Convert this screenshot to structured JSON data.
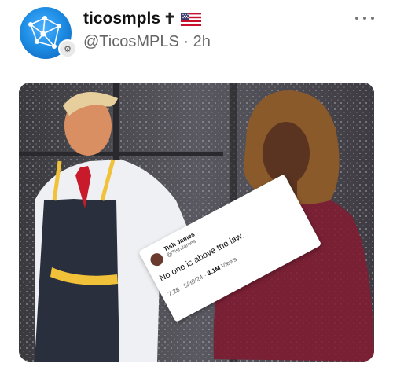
{
  "account": {
    "display_name": "ticosmpls",
    "name_emoji": "✝",
    "flag_icon": "us-flag-icon",
    "handle": "@TicosMPLS",
    "separator": "·",
    "time_ago": "2h"
  },
  "more_icon": "more-horizontal-icon",
  "colors": {
    "avatar_blue": "#1f8fe6",
    "apron_yellow": "#f2c13a",
    "dress_maroon": "#7a2035"
  },
  "media": {
    "embedded_tweet": {
      "name": "Tish James",
      "handle": "@TishJames",
      "text": "No one is above the law.",
      "time": "7:28 · 5/30/24 ·",
      "views_count": "3.1M",
      "views_label": "Views"
    }
  }
}
